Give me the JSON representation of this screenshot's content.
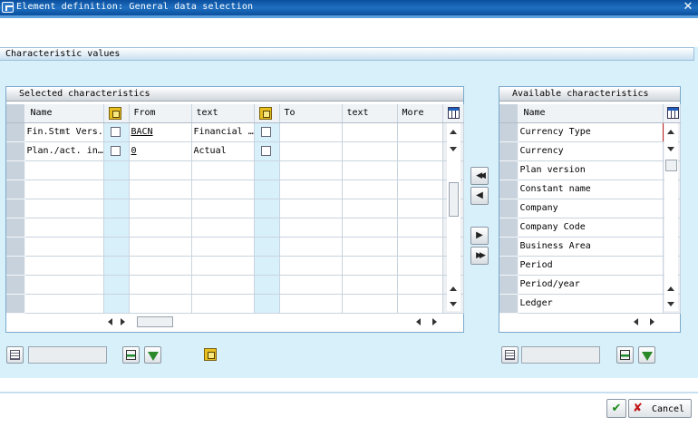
{
  "window": {
    "title": "Element definition: General data selection",
    "close_glyph": "✕"
  },
  "section": {
    "title": "Characteristic values"
  },
  "selected_panel": {
    "title": "Selected characteristics",
    "columns": {
      "name": "Name",
      "from": "From",
      "text": "text",
      "to": "To",
      "text2": "text",
      "more": "More"
    },
    "rows": [
      {
        "name": "Fin.Stmt Vers.",
        "from": "BACN",
        "text": "Financial …",
        "to": "",
        "text2": ""
      },
      {
        "name": "Plan./act. in…",
        "from": "0",
        "text": "Actual",
        "to": "",
        "text2": ""
      }
    ]
  },
  "available_panel": {
    "title": "Available characteristics",
    "column": "Name",
    "items": [
      "Currency Type",
      "Currency",
      "Plan version",
      "Constant name",
      "Company",
      "Company Code",
      "Business Area",
      "Period",
      "Period/year",
      "Ledger"
    ]
  },
  "move_buttons": {
    "add_all": "◀◀",
    "add": "◀",
    "remove": "▶",
    "remove_all": "▶▶"
  },
  "footer": {
    "ok_glyph": "✔",
    "cancel_glyph": "✘",
    "cancel_label": "Cancel"
  },
  "colors": {
    "title_bar": "#0b4f9e",
    "background": "#d8f0fa",
    "ok_green": "#1a8a1a",
    "cancel_red": "#c01818"
  }
}
